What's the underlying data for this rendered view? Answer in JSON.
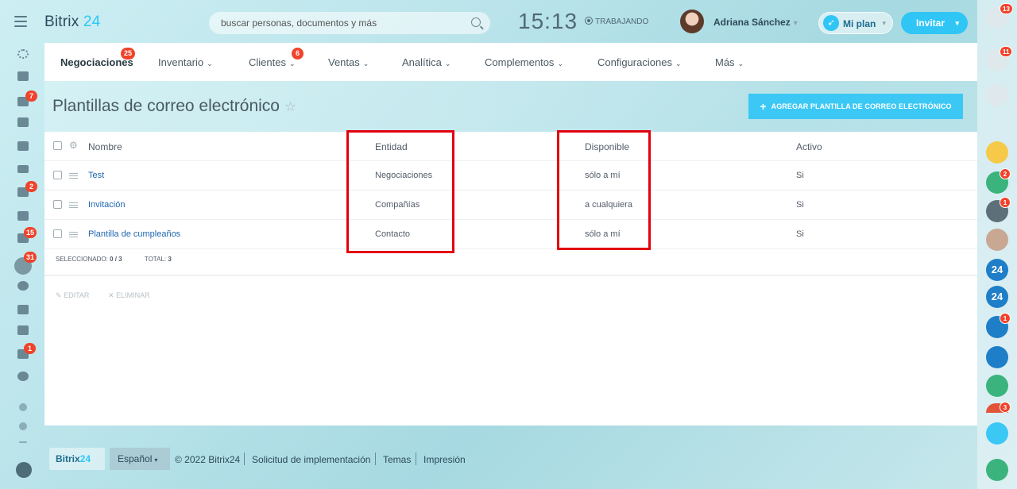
{
  "header": {
    "logo_text": "Bitrix",
    "logo_num": "24",
    "search_placeholder": "buscar personas, documentos y más",
    "clock": "15:13",
    "work_status": "TRABAJANDO",
    "user_name": "Adriana Sánchez",
    "plan_label": "Mi plan",
    "invite_label": "Invitar"
  },
  "nav": {
    "items": [
      {
        "label": "Negociaciones",
        "badge": "25"
      },
      {
        "label": "Inventario"
      },
      {
        "label": "Clientes",
        "badge": "6"
      },
      {
        "label": "Ventas"
      },
      {
        "label": "Analítica"
      },
      {
        "label": "Complementos"
      },
      {
        "label": "Configuraciones"
      },
      {
        "label": "Más"
      }
    ]
  },
  "page": {
    "title": "Plantillas de correo electrónico",
    "add_button": "AGREGAR PLANTILLA DE CORREO ELECTRÓNICO"
  },
  "table": {
    "columns": [
      "Nombre",
      "Entidad",
      "Disponible",
      "Activo"
    ],
    "rows": [
      {
        "name": "Test",
        "entity": "Negociaciones",
        "available": "sólo a mí",
        "active": "Si"
      },
      {
        "name": "Invitación",
        "entity": "Compañías",
        "available": "a cualquiera",
        "active": "Si"
      },
      {
        "name": "Plantilla de cumpleaños",
        "entity": "Contacto",
        "available": "sólo a mí",
        "active": "Si"
      }
    ],
    "selected_label": "SELECCIONADO:",
    "selected_value": "0 / 3",
    "total_label": "TOTAL:",
    "total_value": "3",
    "edit_label": "EDITAR",
    "delete_label": "ELIMINAR"
  },
  "left_badges": {
    "chat": "7",
    "mail": "2",
    "tasks": "15",
    "crm": "31",
    "robots": "1"
  },
  "right_badges": {
    "help": "13",
    "notifications": "11",
    "calendar": "2",
    "group": "1",
    "team": "1",
    "more": "3"
  },
  "right_labels": {
    "b24_1": "24",
    "b24_2": "24"
  },
  "footer": {
    "logo_text": "Bitrix",
    "logo_num": "24",
    "language": "Español",
    "copyright": "© 2022 Bitrix24",
    "implementation": "Solicitud de implementación",
    "themes": "Temas",
    "print": "Impresión"
  },
  "colors": {
    "accent": "#2fc6f6",
    "badge": "#f0432b",
    "highlight": "#e2000f",
    "link": "#2067b0"
  }
}
